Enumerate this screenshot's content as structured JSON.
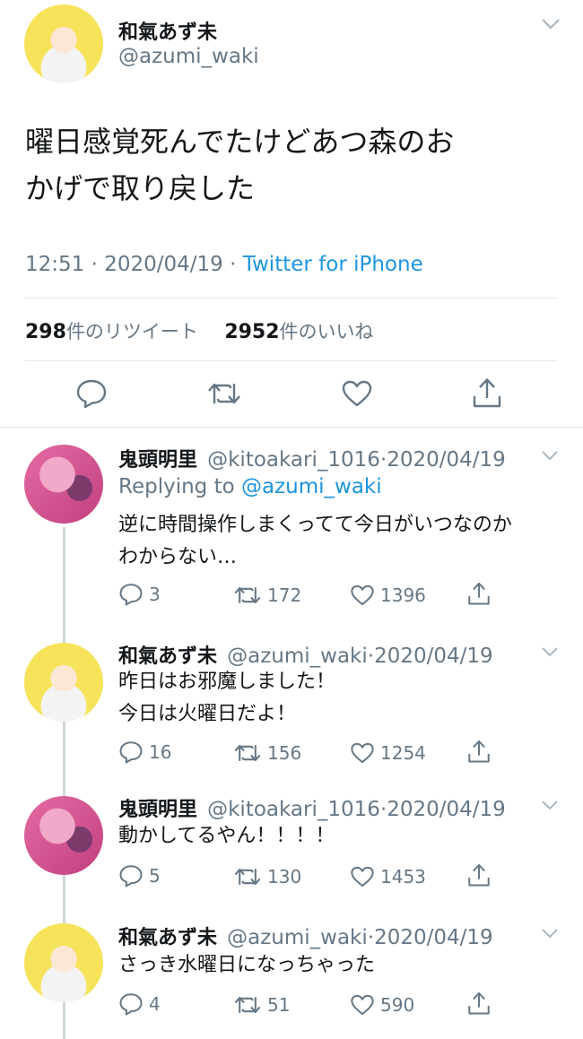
{
  "main_tweet": {
    "display_name": "和氣あず未",
    "handle": "@azumi_waki",
    "text_line1": "曜日感覚死んでたけどあつ森のお",
    "text_line2": "かげで取り戻した",
    "time": "12:51",
    "date": "2020/04/19",
    "source": "Twitter for iPhone",
    "retweet_count": "298",
    "retweet_label": "件のリツイート",
    "like_count": "2952",
    "like_label": "件のいいね"
  },
  "replies": [
    {
      "display_name": "鬼頭明里",
      "handle": "@kitoakari_1016",
      "date": "2020/04/19",
      "replying_prefix": "Replying to",
      "replying_to": "@azumi_waki",
      "text_lines": [
        "逆に時間操作しまくってて今日がいつなのか",
        "わからない…"
      ],
      "reply_count": "3",
      "retweet_count": "172",
      "like_count": "1396"
    },
    {
      "display_name": "和氣あず未",
      "handle": "@azumi_waki",
      "date": "2020/04/19",
      "text_lines": [
        "昨日はお邪魔しました！",
        "今日は火曜日だよ！"
      ],
      "reply_count": "16",
      "retweet_count": "156",
      "like_count": "1254"
    },
    {
      "display_name": "鬼頭明里",
      "handle": "@kitoakari_1016",
      "date": "2020/04/19",
      "text_lines": [
        "動かしてるやん！！！！"
      ],
      "reply_count": "5",
      "retweet_count": "130",
      "like_count": "1453"
    },
    {
      "display_name": "和氣あず未",
      "handle": "@azumi_waki",
      "date": "2020/04/19",
      "text_lines": [
        "さっき水曜日になっちゃった"
      ],
      "reply_count": "4",
      "retweet_count": "51",
      "like_count": "590"
    }
  ],
  "colors": {
    "link": "#1b95e0",
    "secondary_text": "#657786",
    "divider": "#e1e8ed",
    "thread_line": "#ccd6dd"
  },
  "icons": [
    "chevron-down-icon",
    "reply-icon",
    "retweet-icon",
    "like-icon",
    "share-icon"
  ]
}
